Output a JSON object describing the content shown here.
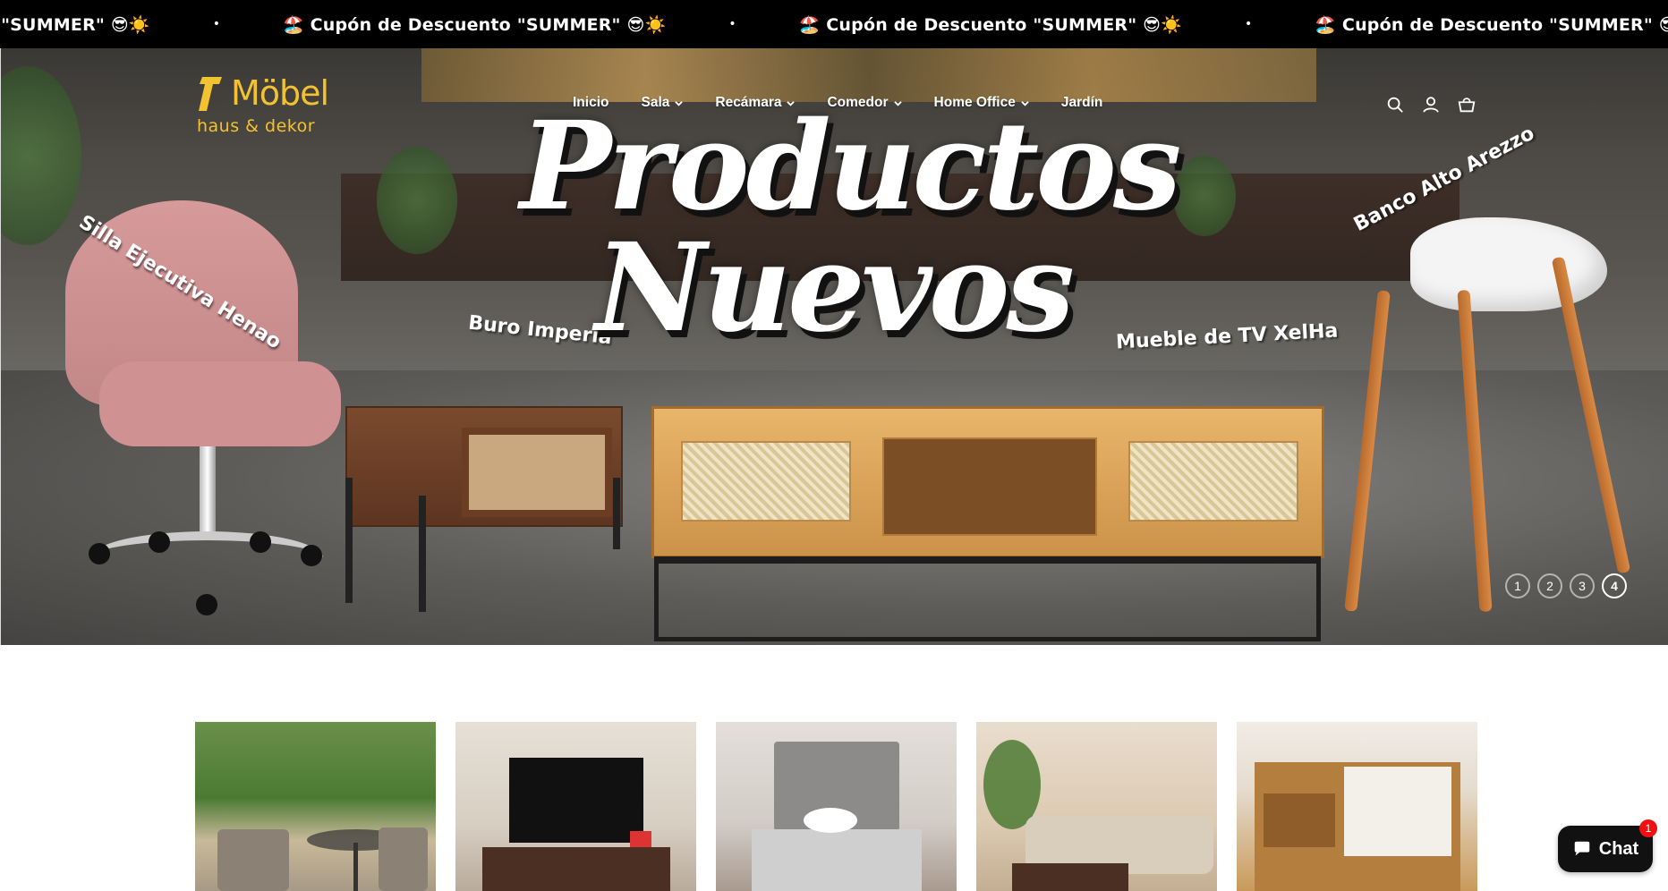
{
  "announcement": {
    "items": [
      "nto \"SUMMER\" 😎☀️",
      "🏖️ Cupón de Descuento \"SUMMER\" 😎☀️",
      "🏖️ Cupón de Descuento \"SUMMER\" 😎☀️",
      "🏖️ Cupón de Descuento \"SUMMER\" 😎☀️"
    ],
    "separator": "•"
  },
  "brand": {
    "name": "Möbel",
    "tagline": "haus & dekor",
    "color": "#f2c230"
  },
  "nav": {
    "items": [
      {
        "label": "Inicio",
        "has_dropdown": false
      },
      {
        "label": "Sala",
        "has_dropdown": true
      },
      {
        "label": "Recámara",
        "has_dropdown": true
      },
      {
        "label": "Comedor",
        "has_dropdown": true
      },
      {
        "label": "Home Office",
        "has_dropdown": true
      },
      {
        "label": "Jardín",
        "has_dropdown": false
      }
    ],
    "icons": [
      "search-icon",
      "account-icon",
      "cart-icon"
    ]
  },
  "hero": {
    "headline_line1": "Productos",
    "headline_line2": "Nuevos",
    "products": [
      {
        "label": "Silla Ejecutiva Henao"
      },
      {
        "label": "Buro Imperia"
      },
      {
        "label": "Mueble de TV XelHa"
      },
      {
        "label": "Banco Alto Arezzo"
      }
    ],
    "slides": [
      "1",
      "2",
      "3",
      "4"
    ],
    "active_slide": 4
  },
  "categories": {
    "tiles": [
      "garden-tile",
      "tv-furniture-tile",
      "bedroom-tile",
      "living-room-tile",
      "wardrobe-tile"
    ]
  },
  "chat": {
    "label": "Chat",
    "badge": "1"
  },
  "colors": {
    "announcement_bg": "#000000",
    "chat_badge": "#e11111"
  }
}
